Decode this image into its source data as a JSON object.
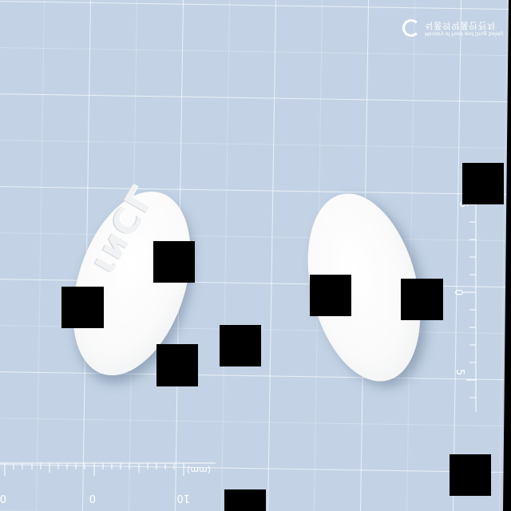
{
  "scene": {
    "logo": {
      "line1": "Ministry of Food and Drug Safety",
      "line2": "식품의약품안전처"
    },
    "left_pill": {
      "imprint": "ιͷCΓ"
    },
    "bottom_ruler": {
      "ticks": [
        "0",
        "0",
        "10"
      ],
      "unit": "(mm)"
    },
    "right_ruler": {
      "ticks": [
        "5",
        "0",
        "5"
      ]
    },
    "colors": {
      "background": "#c3d3e5",
      "grid_line": "#ffffff",
      "pill": "#fafafa",
      "censor_block": "#000000"
    }
  }
}
